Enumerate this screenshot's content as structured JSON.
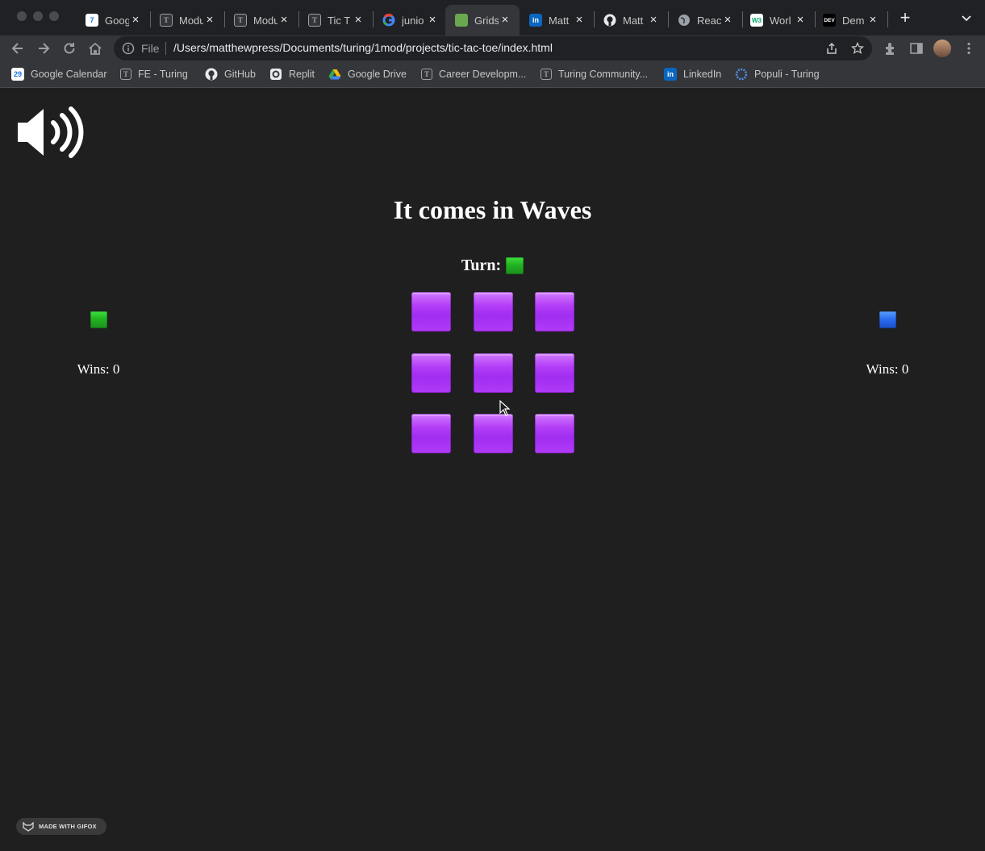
{
  "browser": {
    "tabs": [
      {
        "title": "Goog",
        "icon": "google-calendar-icon"
      },
      {
        "title": "Modu",
        "icon": "turing-icon"
      },
      {
        "title": "Modu",
        "icon": "turing-icon"
      },
      {
        "title": "Tic T",
        "icon": "turing-icon"
      },
      {
        "title": "junio",
        "icon": "google-icon"
      },
      {
        "title": "Grids",
        "icon": "grid-garden-icon",
        "active": true
      },
      {
        "title": "Matt",
        "icon": "linkedin-icon"
      },
      {
        "title": "Matt",
        "icon": "github-icon"
      },
      {
        "title": "Reac",
        "icon": "globe-icon"
      },
      {
        "title": "Worl",
        "icon": "w3schools-icon"
      },
      {
        "title": "Dem",
        "icon": "dev-icon"
      }
    ],
    "address": {
      "scheme_label": "File",
      "url": "/Users/matthewpress/Documents/turing/1mod/projects/tic-tac-toe/index.html"
    },
    "bookmarks": [
      {
        "label": "Google Calendar",
        "icon": "google-calendar-icon"
      },
      {
        "label": "FE  - Turing",
        "icon": "turing-icon"
      },
      {
        "label": "GitHub",
        "icon": "github-icon"
      },
      {
        "label": "Replit",
        "icon": "replit-icon"
      },
      {
        "label": "Google Drive",
        "icon": "google-drive-icon"
      },
      {
        "label": "Career Developm...",
        "icon": "turing-icon"
      },
      {
        "label": "Turing Community...",
        "icon": "turing-icon"
      },
      {
        "label": "LinkedIn",
        "icon": "linkedin-icon"
      },
      {
        "label": "Populi - Turing",
        "icon": "populi-icon"
      }
    ],
    "icon_glyphs": {
      "calendar_day": "7",
      "calendar_day_bookmark": "29",
      "turing": "T",
      "linkedin": "in",
      "w3schools": "W3",
      "dev": "DEV"
    }
  },
  "game": {
    "title": "It comes in Waves",
    "turn_label": "Turn:",
    "current_turn_token": "green-square",
    "player_one": {
      "token": "green-square",
      "wins_text": "Wins: 0"
    },
    "player_two": {
      "token": "blue-square",
      "wins_text": "Wins: 0"
    },
    "board": [
      "purple-square",
      "purple-square",
      "purple-square",
      "purple-square",
      "purple-square",
      "purple-square",
      "purple-square",
      "purple-square",
      "purple-square"
    ],
    "sound_icon": "speaker-high-volume-icon"
  },
  "watermark": {
    "label": "MADE WITH GIFOX",
    "icon": "gifox-fox-icon"
  },
  "colors": {
    "page_background": "#1f1f1f",
    "green_token": "#22b322",
    "blue_token": "#2b6df0",
    "purple_token": "#a02ef0",
    "text": "#ffffff"
  }
}
